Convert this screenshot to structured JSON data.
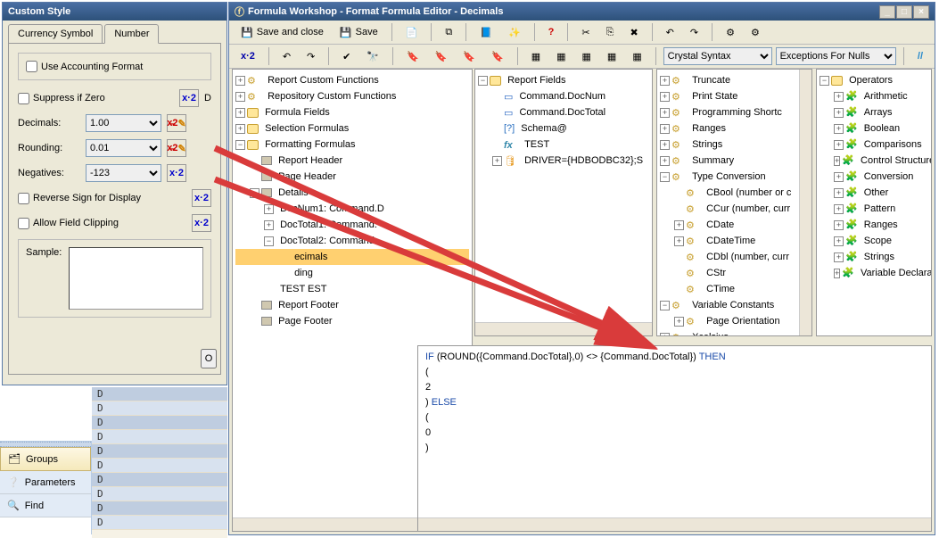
{
  "custom_style": {
    "title": "Custom Style",
    "tabs": {
      "currency": "Currency Symbol",
      "number": "Number"
    },
    "use_accounting": "Use Accounting Format",
    "suppress_zero": "Suppress if Zero",
    "decimals_label": "Decimals:",
    "decimals_value": "1.00",
    "rounding_label": "Rounding:",
    "rounding_value": "0.01",
    "negatives_label": "Negatives:",
    "negatives_value": "-123",
    "reverse_sign": "Reverse Sign for Display",
    "allow_clipping": "Allow Field Clipping",
    "sample_label": "Sample:",
    "ok_button": "O"
  },
  "workshop": {
    "title": "Formula Workshop - Format Formula Editor - Decimals",
    "save_and_close": "Save and close",
    "save": "Save",
    "syntax": "Crystal Syntax",
    "nulls": "Exceptions For Nulls"
  },
  "left_tree": [
    {
      "lvl": 0,
      "exp": "+",
      "icon": "gear",
      "label": "Report Custom Functions"
    },
    {
      "lvl": 0,
      "exp": "+",
      "icon": "gear",
      "label": "Repository Custom Functions"
    },
    {
      "lvl": 0,
      "exp": "+",
      "icon": "fld",
      "label": "Formula Fields"
    },
    {
      "lvl": 0,
      "exp": "+",
      "icon": "fld",
      "label": "Selection Formulas"
    },
    {
      "lvl": 0,
      "exp": "-",
      "icon": "fld",
      "label": "Formatting Formulas"
    },
    {
      "lvl": 1,
      "exp": "",
      "icon": "prn",
      "label": "Report Header"
    },
    {
      "lvl": 1,
      "exp": "",
      "icon": "prn",
      "label": "Page Header"
    },
    {
      "lvl": 1,
      "exp": "-",
      "icon": "prn",
      "label": "Details"
    },
    {
      "lvl": 2,
      "exp": "+",
      "icon": "",
      "label": "DocNum1: Command.D"
    },
    {
      "lvl": 2,
      "exp": "+",
      "icon": "",
      "label": "DocTotal1: Command."
    },
    {
      "lvl": 2,
      "exp": "-",
      "icon": "",
      "label": "DocTotal2: Command."
    },
    {
      "lvl": 3,
      "exp": "",
      "icon": "",
      "label": "ecimals",
      "sel": true
    },
    {
      "lvl": 3,
      "exp": "",
      "icon": "",
      "label": "ding"
    },
    {
      "lvl": 2,
      "exp": "",
      "icon": "",
      "label": "TEST        EST"
    },
    {
      "lvl": 1,
      "exp": "",
      "icon": "prn",
      "label": "Report Footer"
    },
    {
      "lvl": 1,
      "exp": "",
      "icon": "prn",
      "label": "Page Footer"
    }
  ],
  "fields_tree": {
    "root": "Report Fields",
    "items": [
      {
        "icon": "blue",
        "label": "Command.DocNum"
      },
      {
        "icon": "blue",
        "label": "Command.DocTotal"
      },
      {
        "icon": "q",
        "label": "Schema@"
      },
      {
        "icon": "fx",
        "label": "TEST"
      },
      {
        "icon": "db",
        "label": "DRIVER={HDBODBC32};S",
        "exp": "+"
      }
    ]
  },
  "funcs_tree": [
    {
      "exp": "+",
      "label": "Truncate"
    },
    {
      "exp": "+",
      "label": "Print State"
    },
    {
      "exp": "+",
      "label": "Programming Shortc"
    },
    {
      "exp": "+",
      "label": "Ranges"
    },
    {
      "exp": "+",
      "label": "Strings"
    },
    {
      "exp": "+",
      "label": "Summary"
    },
    {
      "exp": "-",
      "label": "Type Conversion"
    },
    {
      "ind": 1,
      "label": "CBool (number or c"
    },
    {
      "ind": 1,
      "label": "CCur (number, curr"
    },
    {
      "exp": "+",
      "ind": 1,
      "label": "CDate"
    },
    {
      "exp": "+",
      "ind": 1,
      "label": "CDateTime"
    },
    {
      "ind": 1,
      "label": "CDbl (number, curr"
    },
    {
      "ind": 1,
      "label": "CStr"
    },
    {
      "ind": 1,
      "label": "CTime"
    },
    {
      "exp": "-",
      "label": "Variable Constants"
    },
    {
      "exp": "+",
      "ind": 1,
      "label": "Page Orientation"
    },
    {
      "exp": "+",
      "label": "Xcelsius"
    }
  ],
  "ops_tree": {
    "root": "Operators",
    "items": [
      "Arithmetic",
      "Arrays",
      "Boolean",
      "Comparisons",
      "Control Structures",
      "Conversion",
      "Other",
      "Pattern",
      "Ranges",
      "Scope",
      "Strings",
      "Variable Declarations"
    ]
  },
  "code": {
    "l1a": "IF",
    "l1b": " (ROUND({Command.DocTotal},0) <> {Command.DocTotal}) ",
    "l1c": "THEN",
    "l2": "(",
    "l3": "    2",
    "l4a": ") ",
    "l4b": "ELSE",
    "l5": "(",
    "l6": "    0",
    "l7": ")"
  },
  "leftnav": {
    "groups": "Groups",
    "params": "Parameters",
    "find": "Find"
  },
  "d_letter": "D"
}
